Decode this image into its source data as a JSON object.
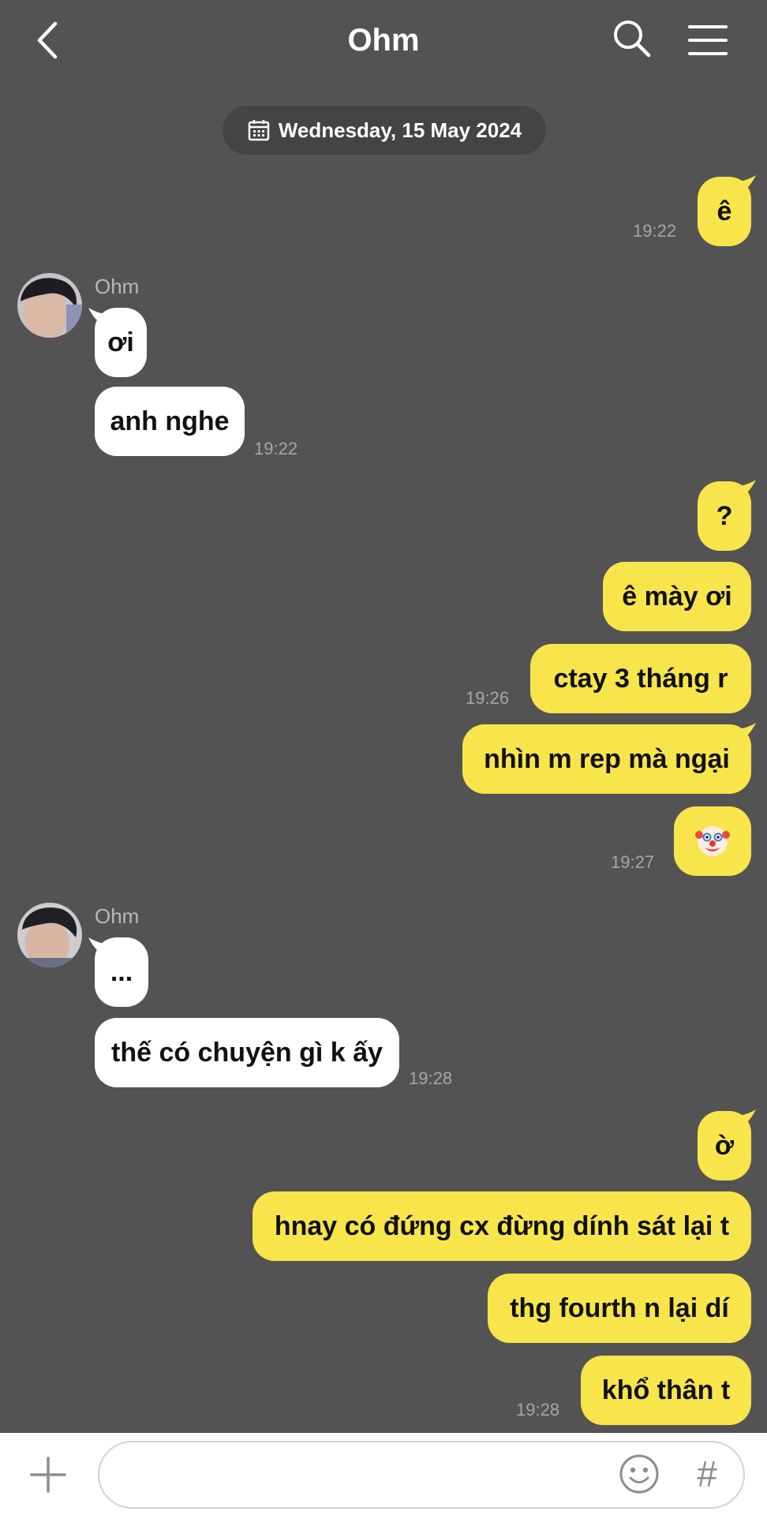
{
  "header": {
    "title": "Ohm"
  },
  "date_divider": "Wednesday, 15 May 2024",
  "messages": {
    "m1": {
      "text": "ê",
      "time": "19:22"
    },
    "g1": {
      "sender": "Ohm",
      "m1": "ơi",
      "m2": "anh nghe",
      "time": "19:22"
    },
    "m2": {
      "text": "?"
    },
    "m3": {
      "text": "ê mày ơi"
    },
    "m4": {
      "text": "ctay 3 tháng r",
      "time": "19:26"
    },
    "m5": {
      "text": "nhìn m rep mà ngại"
    },
    "m6": {
      "emoji": "clown-face",
      "time": "19:27"
    },
    "g2": {
      "sender": "Ohm",
      "m1": "...",
      "m2": "thế có chuyện gì k ấy",
      "time": "19:28"
    },
    "m7": {
      "text": "ờ"
    },
    "m8": {
      "text": "hnay có đứng cx đừng dính sát lại t"
    },
    "m9": {
      "text": "thg fourth n lại dí"
    },
    "m10": {
      "text": "khổ thân t",
      "time": "19:28"
    }
  },
  "composer": {
    "value": "",
    "hash_label": "#"
  },
  "colors": {
    "background": "#545354",
    "my_bubble": "#f7e54b",
    "their_bubble": "#ffffff",
    "accent_text": "#ffffff"
  },
  "icons": [
    "back-arrow-icon",
    "search-icon",
    "menu-icon",
    "calendar-icon",
    "plus-icon",
    "emoji-icon"
  ]
}
